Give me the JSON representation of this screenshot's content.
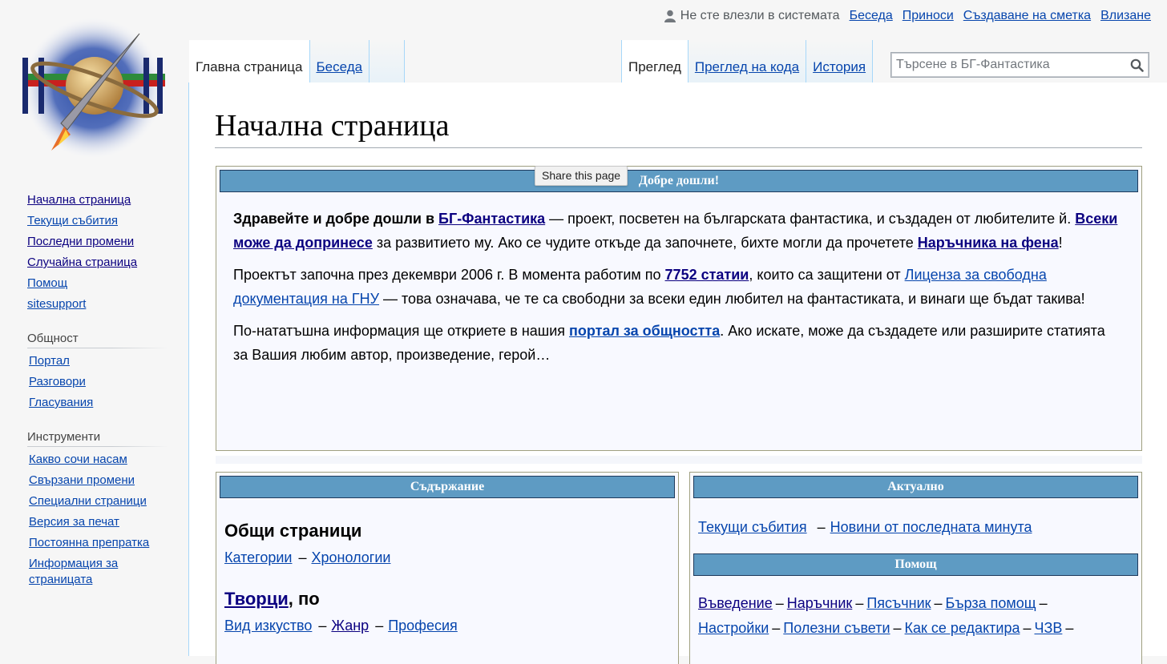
{
  "personal": {
    "anon": "Не сте влезли в системата",
    "links": [
      "Беседа",
      "Приноси",
      "Създаване на сметка",
      "Влизане"
    ]
  },
  "tabs": {
    "left": [
      "Главна страница",
      "Беседа"
    ],
    "right": [
      "Преглед",
      "Преглед на кода",
      "История"
    ]
  },
  "search": {
    "placeholder": "Търсене в БГ-Фантастика"
  },
  "sidebar": {
    "nav": [
      "Начална страница",
      "Текущи събития",
      "Последни промени",
      "Случайна страница",
      "Помощ",
      "sitesupport"
    ],
    "community": {
      "title": "Общност",
      "items": [
        "Портал",
        "Разговори",
        "Гласувания"
      ]
    },
    "tools": {
      "title": "Инструменти",
      "items": [
        "Какво сочи насам",
        "Свързани промени",
        "Специални страници",
        "Версия за печат",
        "Постоянна препратка",
        "Информация за страницата"
      ]
    }
  },
  "page": {
    "title": "Начална страница",
    "share_tip": "Share this page",
    "welcome": {
      "header": "Добре дошли!",
      "p1": {
        "t1": "Здравейте и добре дошли в ",
        "l1": "БГ-Фантастика",
        "t2": " — проект, посветен на българската фантастика, и създаден от любителите й. ",
        "l2": "Всеки може да допринесе",
        "t3": " за развитието му. Ако се чудите откъде да започнете, бихте могли да прочетете ",
        "l3": "Наръчника на фена",
        "t4": "!"
      },
      "p2": {
        "t1": "Проектът започна през декември 2006 г. В момента работим по ",
        "l1": "7752 статии",
        "t2": ", които са защитени от ",
        "l2": "Лиценза за свободна документация на ГНУ",
        "t3": " — това означава, че те са свободни за всеки един любител на фантастиката, и винаги ще бъдат такива!"
      },
      "p3": {
        "t1": "По-нататъшна информация ще откриете в нашия ",
        "l1": "портал за общността",
        "t2": ". Ако искате, може да създадете или разширите статията за Вашия любим автор, произведение, герой…"
      }
    },
    "contents": {
      "header": "Съдържание",
      "general_title": "Общи страници",
      "general_links": [
        "Категории",
        "Хронологии"
      ],
      "creators_link": "Творци",
      "creators_suffix": ", по",
      "creators_links": [
        "Вид изкуство",
        "Жанр",
        "Професия"
      ]
    },
    "actual": {
      "header": "Актуално",
      "links": [
        "Текущи събития",
        "Новини от последната минута"
      ],
      "help_header": "Помощ",
      "help_line1": [
        "Въведение",
        "Наръчник",
        "Пясъчник",
        "Бърза помощ"
      ],
      "help_line2": [
        "Настройки",
        "Полезни съвети",
        "Как се редактира",
        "ЧЗВ"
      ]
    }
  }
}
